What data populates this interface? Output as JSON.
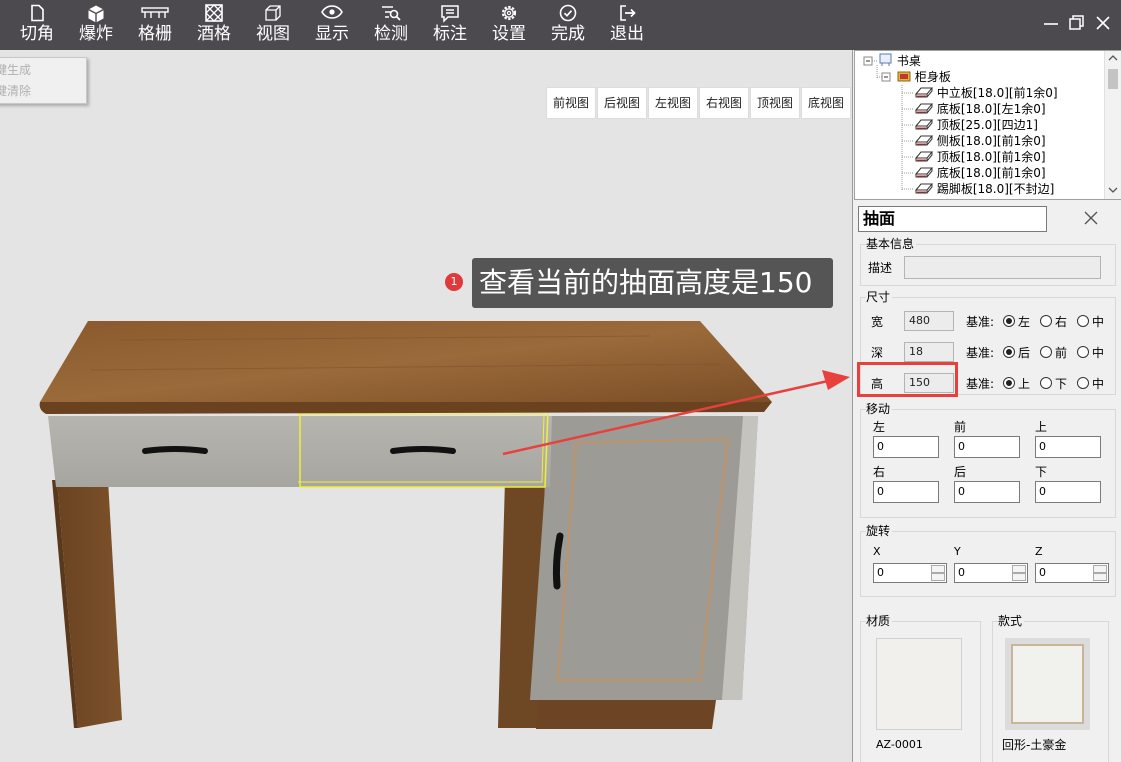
{
  "toolbar": {
    "items": [
      {
        "label": "切角",
        "icon": "document-icon"
      },
      {
        "label": "爆炸",
        "icon": "cube-icon"
      },
      {
        "label": "格栅",
        "icon": "grille-icon"
      },
      {
        "label": "酒格",
        "icon": "lattice-icon"
      },
      {
        "label": "视图",
        "icon": "view-cube-icon"
      },
      {
        "label": "显示",
        "icon": "eye-icon"
      },
      {
        "label": "检测",
        "icon": "inspect-list-icon"
      },
      {
        "label": "标注",
        "icon": "comment-icon"
      },
      {
        "label": "设置",
        "icon": "gear-icon"
      },
      {
        "label": "完成",
        "icon": "check-circle-icon"
      },
      {
        "label": "退出",
        "icon": "exit-icon"
      }
    ]
  },
  "window_controls": [
    "minimize-icon",
    "restore-icon",
    "close-icon"
  ],
  "context_menu": {
    "items": [
      "键生成",
      "键清除"
    ]
  },
  "view_buttons": [
    "前视图",
    "后视图",
    "左视图",
    "右视图",
    "顶视图",
    "底视图"
  ],
  "callout": {
    "badge": "1",
    "text": "查看当前的抽面高度是150"
  },
  "tree": {
    "root": "书桌",
    "group": "柜身板",
    "items": [
      "中立板[18.0][前1余0]",
      "底板[18.0][左1余0]",
      "顶板[25.0][四边1]",
      "侧板[18.0][前1余0]",
      "顶板[18.0][前1余0]",
      "底板[18.0][前1余0]",
      "踢脚板[18.0][不封边]"
    ]
  },
  "panel": {
    "name": "抽面",
    "basic_info": {
      "title": "基本信息",
      "desc_label": "描述",
      "desc_value": ""
    },
    "size": {
      "title": "尺寸",
      "rows": [
        {
          "label": "宽",
          "value": "480",
          "base_label": "基准:",
          "options": [
            "左",
            "右",
            "中"
          ],
          "selected": 0
        },
        {
          "label": "深",
          "value": "18",
          "base_label": "基准:",
          "options": [
            "后",
            "前",
            "中"
          ],
          "selected": 0
        },
        {
          "label": "高",
          "value": "150",
          "base_label": "基准:",
          "options": [
            "上",
            "下",
            "中"
          ],
          "selected": 0
        }
      ]
    },
    "move": {
      "title": "移动",
      "fields": [
        {
          "label": "左",
          "value": "0"
        },
        {
          "label": "前",
          "value": "0"
        },
        {
          "label": "上",
          "value": "0"
        },
        {
          "label": "右",
          "value": "0"
        },
        {
          "label": "后",
          "value": "0"
        },
        {
          "label": "下",
          "value": "0"
        }
      ]
    },
    "rotate": {
      "title": "旋转",
      "fields": [
        {
          "label": "X",
          "value": "0"
        },
        {
          "label": "Y",
          "value": "0"
        },
        {
          "label": "Z",
          "value": "0"
        }
      ]
    },
    "material": {
      "title": "材质",
      "name": "AZ-0001",
      "swatch_color": "#f1f0ec"
    },
    "style": {
      "title": "款式",
      "name": "回形-土豪金",
      "frame_color": "#c8b496"
    }
  },
  "colors": {
    "toolbar_bg": "#4d4a4f",
    "highlight_red": "#e8403d",
    "selection_yellow": "#f2ee3a"
  }
}
